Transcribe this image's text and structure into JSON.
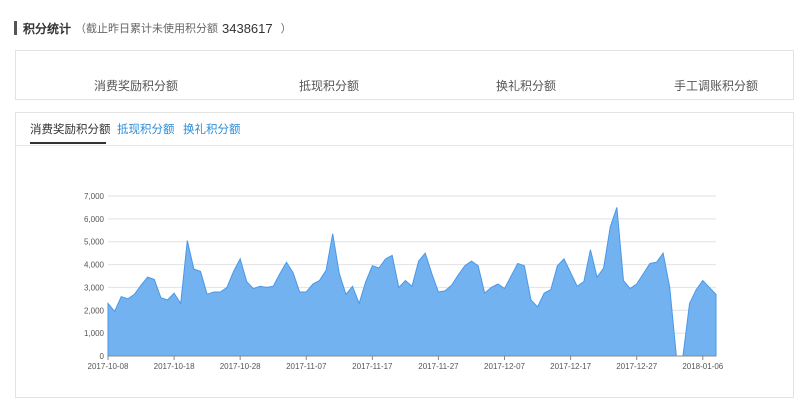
{
  "header": {
    "title": "积分统计",
    "note_prefix": "（截止昨日累计未使用积分额",
    "total": "3438617",
    "note_suffix": "）"
  },
  "stats": [
    {
      "value": "",
      "label": "消费奖励积分额"
    },
    {
      "value": "",
      "label": "抵现积分额"
    },
    {
      "value": "",
      "label": "换礼积分额"
    },
    {
      "value": "",
      "label": "手工调账积分额"
    }
  ],
  "tabs": [
    {
      "label": "消费奖励积分额",
      "active": true
    },
    {
      "label": "抵现积分额",
      "active": false
    },
    {
      "label": "换礼积分额",
      "active": false
    }
  ],
  "colors": {
    "area": "#6aaef0",
    "line": "#4a98e6",
    "accent": "#2a8ed8"
  },
  "chart_data": {
    "type": "area",
    "start_date": "2017-10-08",
    "x_tick_labels": [
      "2017-10-08",
      "2017-10-18",
      "2017-10-28",
      "2017-11-07",
      "2017-11-17",
      "2017-11-27",
      "2017-12-07",
      "2017-12-17",
      "2017-12-27",
      "2018-01-06"
    ],
    "y_tick_labels": [
      "0",
      "1,000",
      "2,000",
      "3,000",
      "4,000",
      "5,000",
      "6,000",
      "7,000"
    ],
    "ylim": [
      0,
      7000
    ],
    "grid": true,
    "values": [
      2300,
      1950,
      2600,
      2500,
      2700,
      3100,
      3450,
      3350,
      2550,
      2450,
      2750,
      2300,
      5050,
      3800,
      3700,
      2700,
      2800,
      2800,
      3000,
      3700,
      4250,
      3250,
      2950,
      3050,
      3000,
      3050,
      3600,
      4100,
      3650,
      2800,
      2800,
      3150,
      3300,
      3750,
      5350,
      3600,
      2700,
      3050,
      2300,
      3250,
      3950,
      3850,
      4250,
      4400,
      3000,
      3300,
      3050,
      4150,
      4500,
      3600,
      2800,
      2850,
      3100,
      3550,
      3950,
      4150,
      3950,
      2750,
      3000,
      3150,
      2950,
      3500,
      4050,
      3950,
      2450,
      2150,
      2750,
      2900,
      3950,
      4250,
      3650,
      3050,
      3250,
      4650,
      3450,
      3850,
      5650,
      6500,
      3300,
      2950,
      3150,
      3600,
      4050,
      4100,
      4500,
      3000,
      0,
      0,
      2300,
      2900,
      3300,
      3000,
      2700
    ]
  }
}
